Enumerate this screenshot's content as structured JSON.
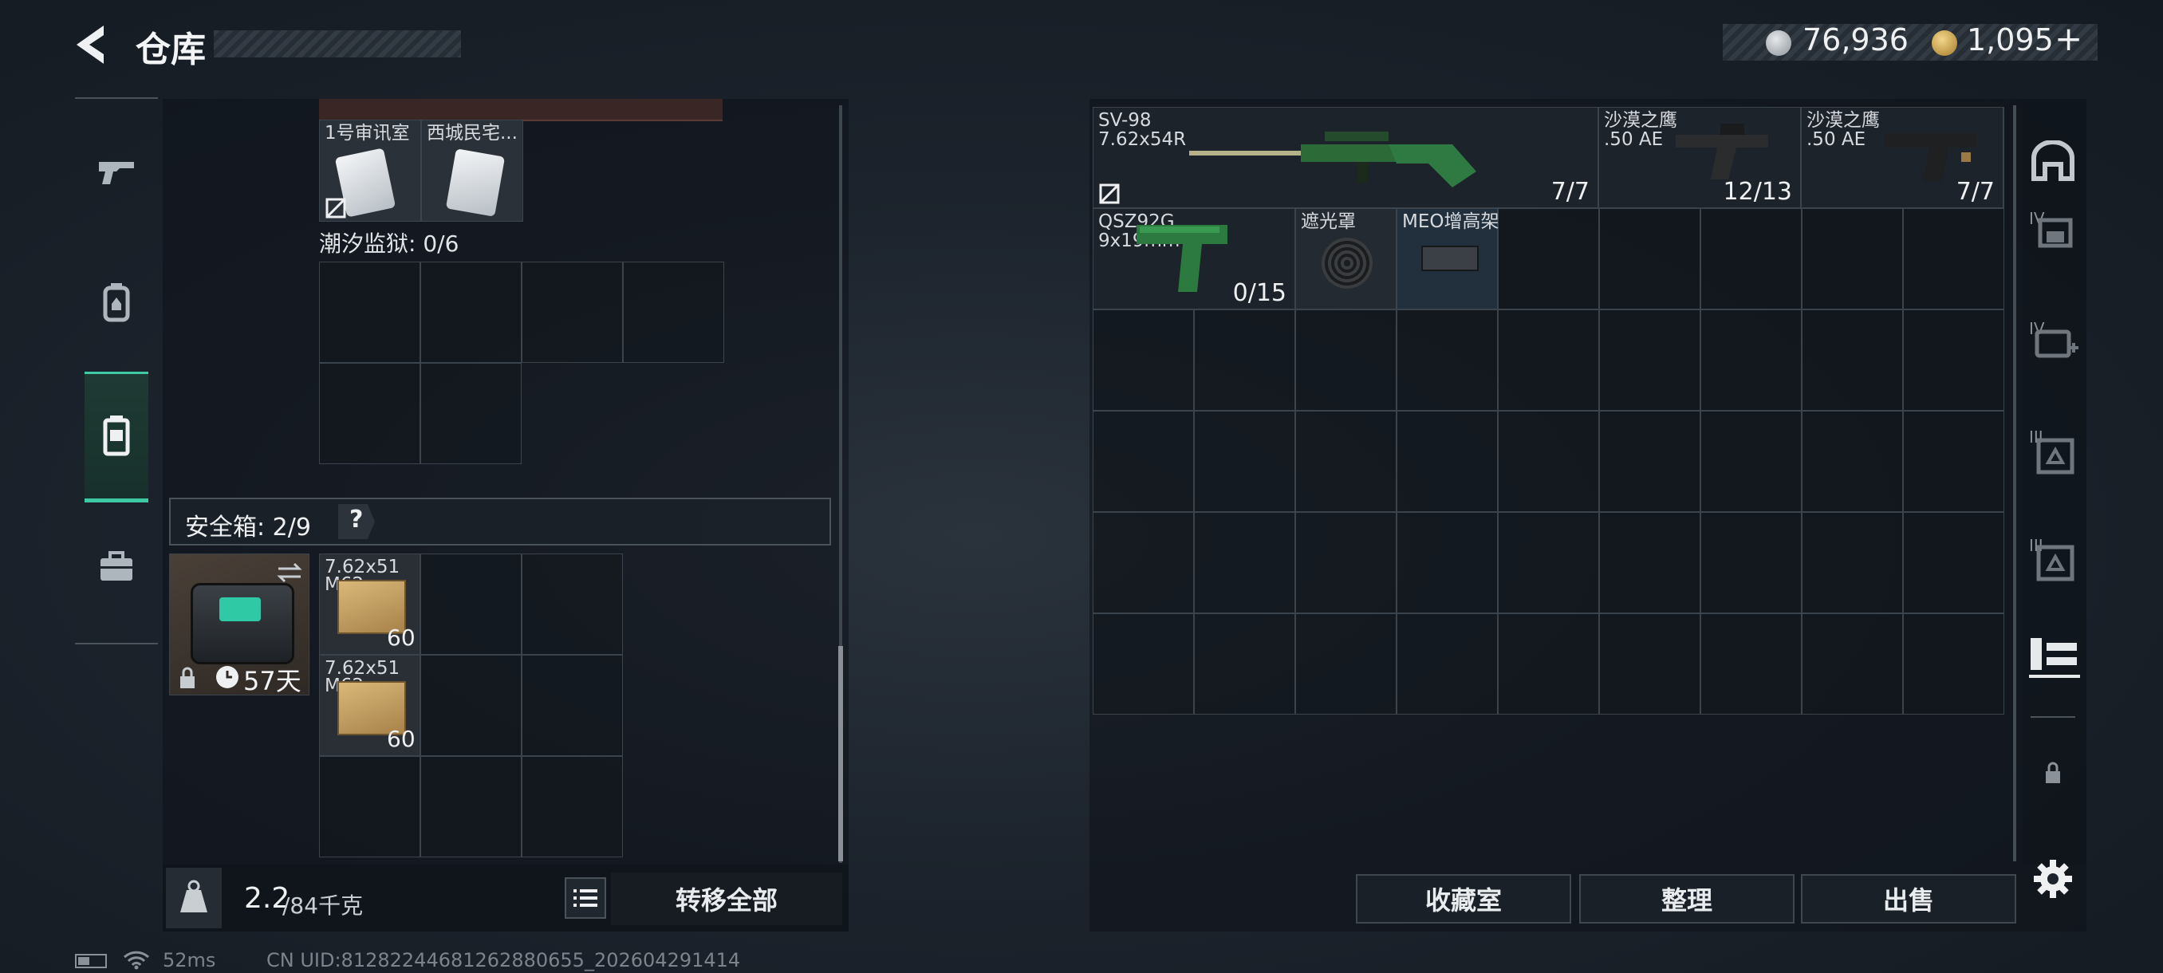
{
  "header": {
    "back_icon": "back-arrow-icon",
    "title": "仓库",
    "currency1": {
      "icon": "silver-coin-icon",
      "value": "76,936"
    },
    "currency2": {
      "icon": "gold-coin-icon",
      "value": "1,095",
      "add_label": "+"
    }
  },
  "left_tabs": [
    {
      "icon": "gun-icon",
      "active": false
    },
    {
      "icon": "backpack-icon",
      "active": false
    },
    {
      "icon": "container-icon",
      "active": true
    },
    {
      "icon": "toolbox-icon",
      "active": false
    }
  ],
  "stash": {
    "cards": [
      {
        "name": "1号审讯室",
        "lock_icon": "no-trade-icon"
      },
      {
        "name": "西城民宅..."
      }
    ],
    "prison_label": "潮汐监狱: 0/6",
    "safe_box_label": "安全箱: 2/9",
    "safe_box_help": "?",
    "safe_box_days": "57天",
    "ammo": [
      {
        "name": "7.62x51",
        "sub": "M62",
        "count": "60"
      },
      {
        "name": "7.62x51",
        "sub": "M62",
        "count": "60"
      }
    ]
  },
  "bottom_left": {
    "weight": "2.2",
    "weight_max": "/84千克",
    "transfer_all": "转移全部"
  },
  "right_items": [
    {
      "name": "SV-98",
      "sub": "7.62x54R",
      "count": "7/7"
    },
    {
      "name": "沙漠之鹰",
      "sub": ".50 AE",
      "count": "12/13"
    },
    {
      "name": "沙漠之鹰",
      "sub": ".50 AE",
      "count": "7/7"
    },
    {
      "name": "QSZ92G",
      "sub": "9x19mm",
      "count": "0/15"
    },
    {
      "name": "遮光罩",
      "sub": "",
      "count": ""
    },
    {
      "name": "MEO增高架",
      "sub": "",
      "count": ""
    }
  ],
  "right_tabs": [
    "helmet-icon",
    "armor-iv-icon",
    "medkit-iv-icon",
    "rig-iii-icon",
    "rig-iii-alt-icon",
    "weapon-rack-icon",
    "lock-icon"
  ],
  "right_tab_labels": [
    "IV",
    "IV",
    "III",
    "III"
  ],
  "actions": {
    "collection": "收藏室",
    "organize": "整理",
    "sell": "出售"
  },
  "status": {
    "ping": "52ms",
    "uid": "CN UID:812822446812628806​55_202604291414"
  }
}
